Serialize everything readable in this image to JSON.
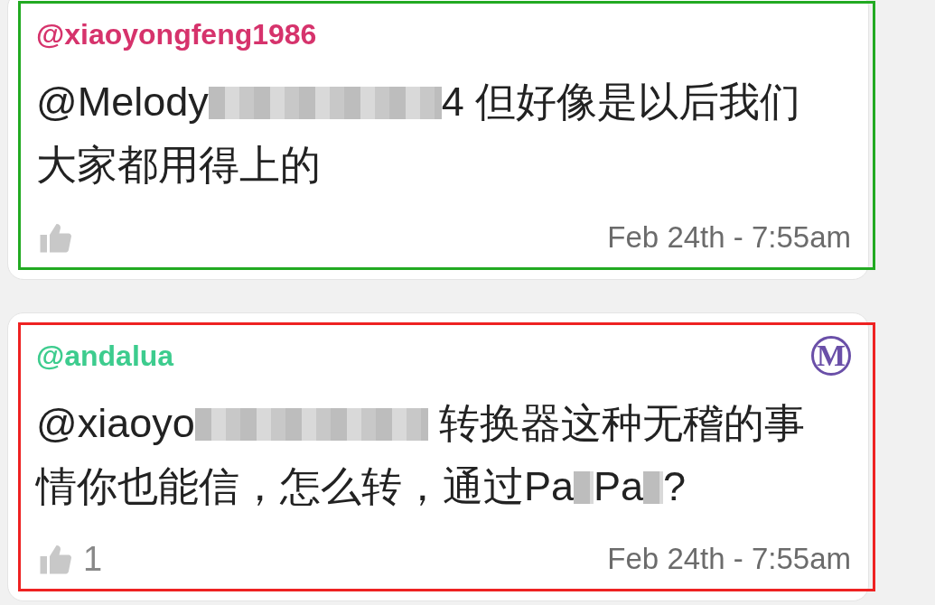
{
  "comments": [
    {
      "author": {
        "name": "@xiaoyongfeng1986",
        "color": "#d6336c"
      },
      "frame": {
        "color": "#22aa22"
      },
      "lines": [
        [
          {
            "kind": "text",
            "text": "@Melody"
          },
          {
            "kind": "blur"
          },
          {
            "kind": "text",
            "text": "4 但好像是以后我们"
          }
        ],
        [
          {
            "kind": "text",
            "text": "大家都用得上的"
          }
        ]
      ],
      "time": "Feb 24th - 7:55am"
    },
    {
      "author": {
        "name": "@andalua",
        "color": "#3dcc8e"
      },
      "frame": {
        "color": "#ee2222"
      },
      "badge": "M",
      "lines": [
        [
          {
            "kind": "text",
            "text": "@xiaoyo"
          },
          {
            "kind": "blur"
          },
          {
            "kind": "text",
            "text": " 转换器这种无稽的事"
          }
        ],
        [
          {
            "kind": "text",
            "text": "情你也能信，怎么转，通过Pa"
          },
          {
            "kind": "smudge"
          },
          {
            "kind": "text",
            "text": "Pa"
          },
          {
            "kind": "smudge"
          },
          {
            "kind": "text",
            "text": "?"
          }
        ]
      ],
      "likes": "1",
      "time": "Feb 24th - 7:55am"
    }
  ]
}
